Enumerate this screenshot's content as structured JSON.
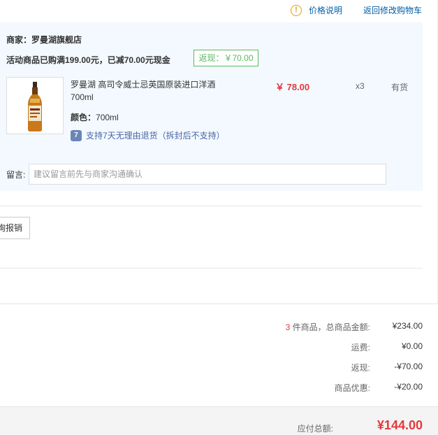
{
  "top": {
    "price_note": "价格说明",
    "price_note_icon": "exclamation-circle-icon",
    "back_to_cart": "返回修改购物车"
  },
  "shop": {
    "name": "商家：罗曼湖旗舰店",
    "promo": "活动商品已购满199.00元，已减70.00元现金",
    "rebate": "返现：￥70.00"
  },
  "product": {
    "title": "罗曼湖 高司令威士忌英国原装进口洋酒700ml",
    "price": "￥ 78.00",
    "qty": "x3",
    "stock": "有货",
    "color_label": "颜色：",
    "color_value": "700ml",
    "return_icon_text": "7",
    "return_policy": "支持7天无理由退货（拆封后不支持）",
    "image_icon": "whisky-bottle-image"
  },
  "message": {
    "label": "留言:",
    "placeholder": "建议留言前先与商家沟通确认"
  },
  "invoice": {
    "button_label": "询报销"
  },
  "summary": {
    "count": "3",
    "count_suffix": " 件商品，总商品金额:",
    "goods_total": "¥234.00",
    "shipping_label": "运费:",
    "shipping": "¥0.00",
    "rebate_label": "返现:",
    "rebate": "-¥70.00",
    "discount_label": "商品优惠:",
    "discount": "-¥20.00"
  },
  "total": {
    "label": "应付总额:",
    "value": "¥144.00"
  },
  "colors": {
    "accent_red": "#e4393c",
    "link_blue": "#005ea7",
    "panel_bg": "#f3f9fe",
    "rebate_green": "#5cb85c"
  }
}
